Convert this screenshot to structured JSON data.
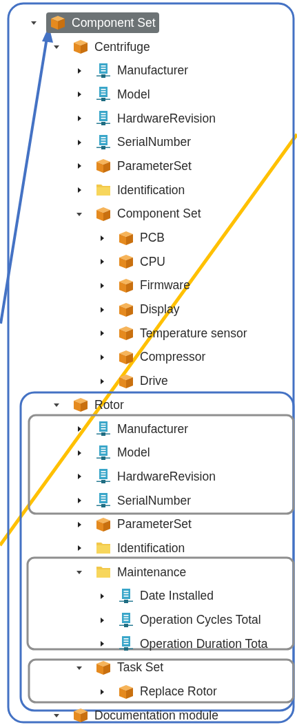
{
  "tree": [
    {
      "label": "Component Set",
      "kind": "box",
      "expanded": true,
      "selected": true,
      "children": [
        {
          "label": "Centrifuge",
          "kind": "box",
          "expanded": true,
          "selected": false,
          "children": [
            {
              "label": "Manufacturer",
              "kind": "property",
              "expanded": false,
              "selected": false
            },
            {
              "label": "Model",
              "kind": "property",
              "expanded": false,
              "selected": false
            },
            {
              "label": "HardwareRevision",
              "kind": "property",
              "expanded": false,
              "selected": false
            },
            {
              "label": "SerialNumber",
              "kind": "property",
              "expanded": false,
              "selected": false
            },
            {
              "label": "ParameterSet",
              "kind": "box",
              "expanded": false,
              "selected": false
            },
            {
              "label": "Identification",
              "kind": "folder",
              "expanded": false,
              "selected": false
            },
            {
              "label": "Component Set",
              "kind": "box",
              "expanded": true,
              "selected": false,
              "children": [
                {
                  "label": "PCB",
                  "kind": "box",
                  "expanded": false,
                  "selected": false
                },
                {
                  "label": "CPU",
                  "kind": "box",
                  "expanded": false,
                  "selected": false
                },
                {
                  "label": "Firmware",
                  "kind": "box",
                  "expanded": false,
                  "selected": false
                },
                {
                  "label": "Display",
                  "kind": "box",
                  "expanded": false,
                  "selected": false
                },
                {
                  "label": "Temperature sensor",
                  "kind": "box",
                  "expanded": false,
                  "selected": false
                },
                {
                  "label": "Compressor",
                  "kind": "box",
                  "expanded": false,
                  "selected": false
                },
                {
                  "label": "Drive",
                  "kind": "box",
                  "expanded": false,
                  "selected": false
                }
              ]
            }
          ]
        },
        {
          "label": "Rotor",
          "kind": "box",
          "expanded": true,
          "selected": false,
          "children": [
            {
              "label": "Manufacturer",
              "kind": "property",
              "expanded": false,
              "selected": false
            },
            {
              "label": "Model",
              "kind": "property",
              "expanded": false,
              "selected": false
            },
            {
              "label": "HardwareRevision",
              "kind": "property",
              "expanded": false,
              "selected": false
            },
            {
              "label": "SerialNumber",
              "kind": "property",
              "expanded": false,
              "selected": false
            },
            {
              "label": "ParameterSet",
              "kind": "box",
              "expanded": false,
              "selected": false
            },
            {
              "label": "Identification",
              "kind": "folder",
              "expanded": false,
              "selected": false
            },
            {
              "label": "Maintenance",
              "kind": "folder",
              "expanded": true,
              "selected": false,
              "children": [
                {
                  "label": "Date Installed",
                  "kind": "property",
                  "expanded": false,
                  "selected": false
                },
                {
                  "label": "Operation Cycles Total",
                  "kind": "property",
                  "expanded": false,
                  "selected": false
                },
                {
                  "label": "Operation Duration Tota",
                  "kind": "property",
                  "expanded": false,
                  "selected": false
                }
              ]
            },
            {
              "label": "Task Set",
              "kind": "box",
              "expanded": true,
              "selected": false,
              "children": [
                {
                  "label": "Replace Rotor",
                  "kind": "box",
                  "expanded": false,
                  "selected": false
                }
              ]
            }
          ]
        },
        {
          "label": "Documentation module",
          "kind": "box",
          "expanded": true,
          "selected": false
        }
      ]
    }
  ]
}
